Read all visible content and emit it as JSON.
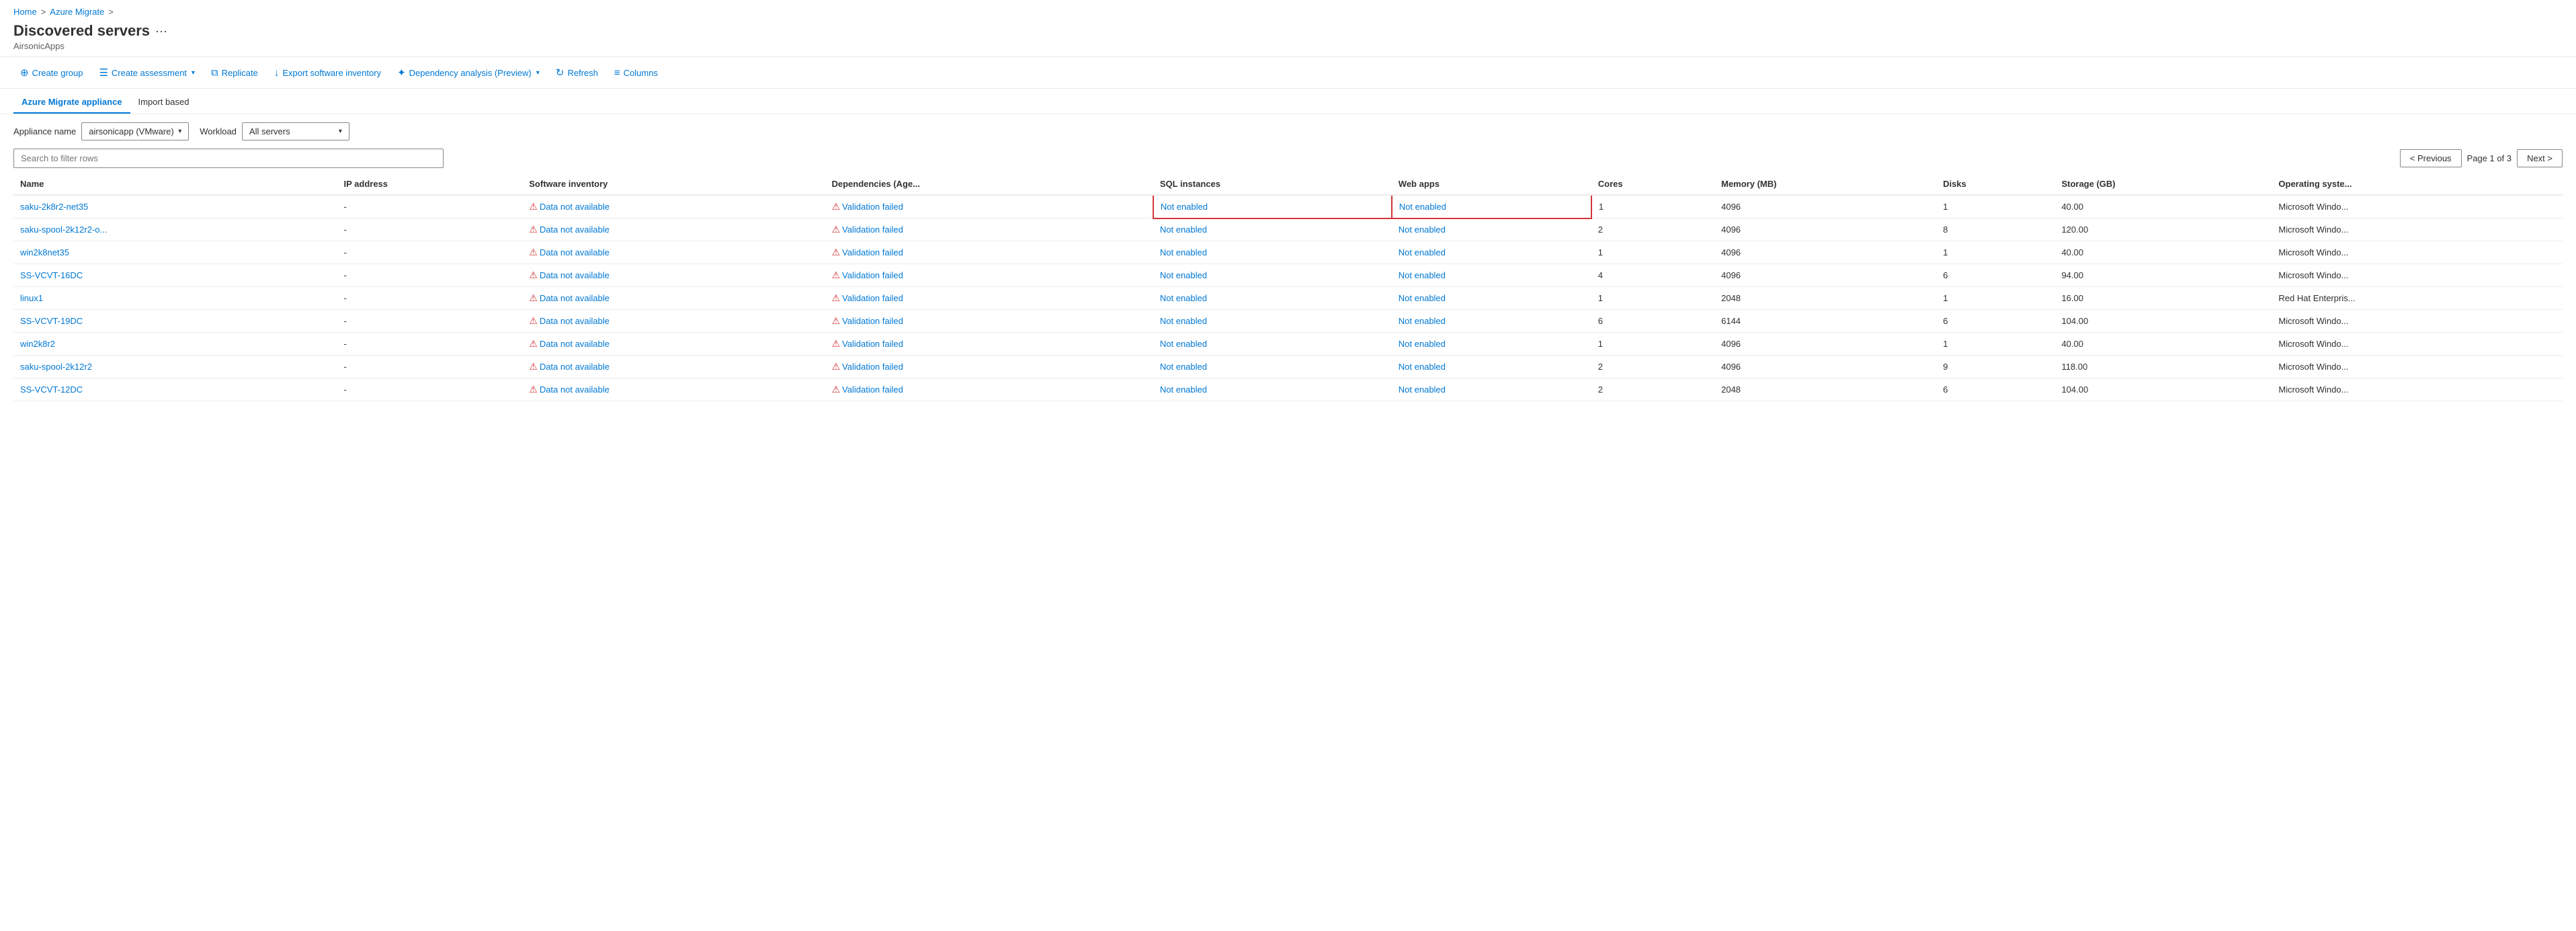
{
  "breadcrumb": {
    "home": "Home",
    "separator1": ">",
    "azure_migrate": "Azure Migrate",
    "separator2": ">"
  },
  "page": {
    "title": "Discovered servers",
    "more_label": "···",
    "project_name": "AirsonicApps"
  },
  "toolbar": {
    "create_group": "Create group",
    "create_assessment": "Create assessment",
    "replicate": "Replicate",
    "export_software_inventory": "Export software inventory",
    "dependency_analysis": "Dependency analysis (Preview)",
    "refresh": "Refresh",
    "columns": "Columns"
  },
  "tabs": [
    {
      "label": "Azure Migrate appliance",
      "active": true
    },
    {
      "label": "Import based",
      "active": false
    }
  ],
  "filters": {
    "appliance_label": "Appliance name",
    "appliance_value": "airsonicapp (VMware)",
    "workload_label": "Workload",
    "workload_value": "All servers"
  },
  "search": {
    "placeholder": "Search to filter rows"
  },
  "pagination": {
    "previous": "< Previous",
    "page_info": "Page 1 of 3",
    "next": "Next >"
  },
  "columns": [
    "Name",
    "IP address",
    "Software inventory",
    "Dependencies (Age...",
    "SQL instances",
    "Web apps",
    "Cores",
    "Memory (MB)",
    "Disks",
    "Storage (GB)",
    "Operating syste..."
  ],
  "rows": [
    {
      "name": "saku-2k8r2-net35",
      "ip": "-",
      "software_inventory": "Data not available",
      "dependencies": "Validation failed",
      "sql_instances": "Not enabled",
      "web_apps": "Not enabled",
      "cores": "1",
      "memory": "4096",
      "disks": "1",
      "storage": "40.00",
      "os": "Microsoft Windo...",
      "highlighted": true
    },
    {
      "name": "saku-spool-2k12r2-o...",
      "ip": "-",
      "software_inventory": "Data not available",
      "dependencies": "Validation failed",
      "sql_instances": "Not enabled",
      "web_apps": "Not enabled",
      "cores": "2",
      "memory": "4096",
      "disks": "8",
      "storage": "120.00",
      "os": "Microsoft Windo...",
      "highlighted": false
    },
    {
      "name": "win2k8net35",
      "ip": "-",
      "software_inventory": "Data not available",
      "dependencies": "Validation failed",
      "sql_instances": "Not enabled",
      "web_apps": "Not enabled",
      "cores": "1",
      "memory": "4096",
      "disks": "1",
      "storage": "40.00",
      "os": "Microsoft Windo...",
      "highlighted": false
    },
    {
      "name": "SS-VCVT-16DC",
      "ip": "-",
      "software_inventory": "Data not available",
      "dependencies": "Validation failed",
      "sql_instances": "Not enabled",
      "web_apps": "Not enabled",
      "cores": "4",
      "memory": "4096",
      "disks": "6",
      "storage": "94.00",
      "os": "Microsoft Windo...",
      "highlighted": false
    },
    {
      "name": "linux1",
      "ip": "-",
      "software_inventory": "Data not available",
      "dependencies": "Validation failed",
      "sql_instances": "Not enabled",
      "web_apps": "Not enabled",
      "cores": "1",
      "memory": "2048",
      "disks": "1",
      "storage": "16.00",
      "os": "Red Hat Enterpris...",
      "highlighted": false
    },
    {
      "name": "SS-VCVT-19DC",
      "ip": "-",
      "software_inventory": "Data not available",
      "dependencies": "Validation failed",
      "sql_instances": "Not enabled",
      "web_apps": "Not enabled",
      "cores": "6",
      "memory": "6144",
      "disks": "6",
      "storage": "104.00",
      "os": "Microsoft Windo...",
      "highlighted": false
    },
    {
      "name": "win2k8r2",
      "ip": "-",
      "software_inventory": "Data not available",
      "dependencies": "Validation failed",
      "sql_instances": "Not enabled",
      "web_apps": "Not enabled",
      "cores": "1",
      "memory": "4096",
      "disks": "1",
      "storage": "40.00",
      "os": "Microsoft Windo...",
      "highlighted": false
    },
    {
      "name": "saku-spool-2k12r2",
      "ip": "-",
      "software_inventory": "Data not available",
      "dependencies": "Validation failed",
      "sql_instances": "Not enabled",
      "web_apps": "Not enabled",
      "cores": "2",
      "memory": "4096",
      "disks": "9",
      "storage": "118.00",
      "os": "Microsoft Windo...",
      "highlighted": false
    },
    {
      "name": "SS-VCVT-12DC",
      "ip": "-",
      "software_inventory": "Data not available",
      "dependencies": "Validation failed",
      "sql_instances": "Not enabled",
      "web_apps": "Not enabled",
      "cores": "2",
      "memory": "2048",
      "disks": "6",
      "storage": "104.00",
      "os": "Microsoft Windo...",
      "highlighted": false
    }
  ]
}
